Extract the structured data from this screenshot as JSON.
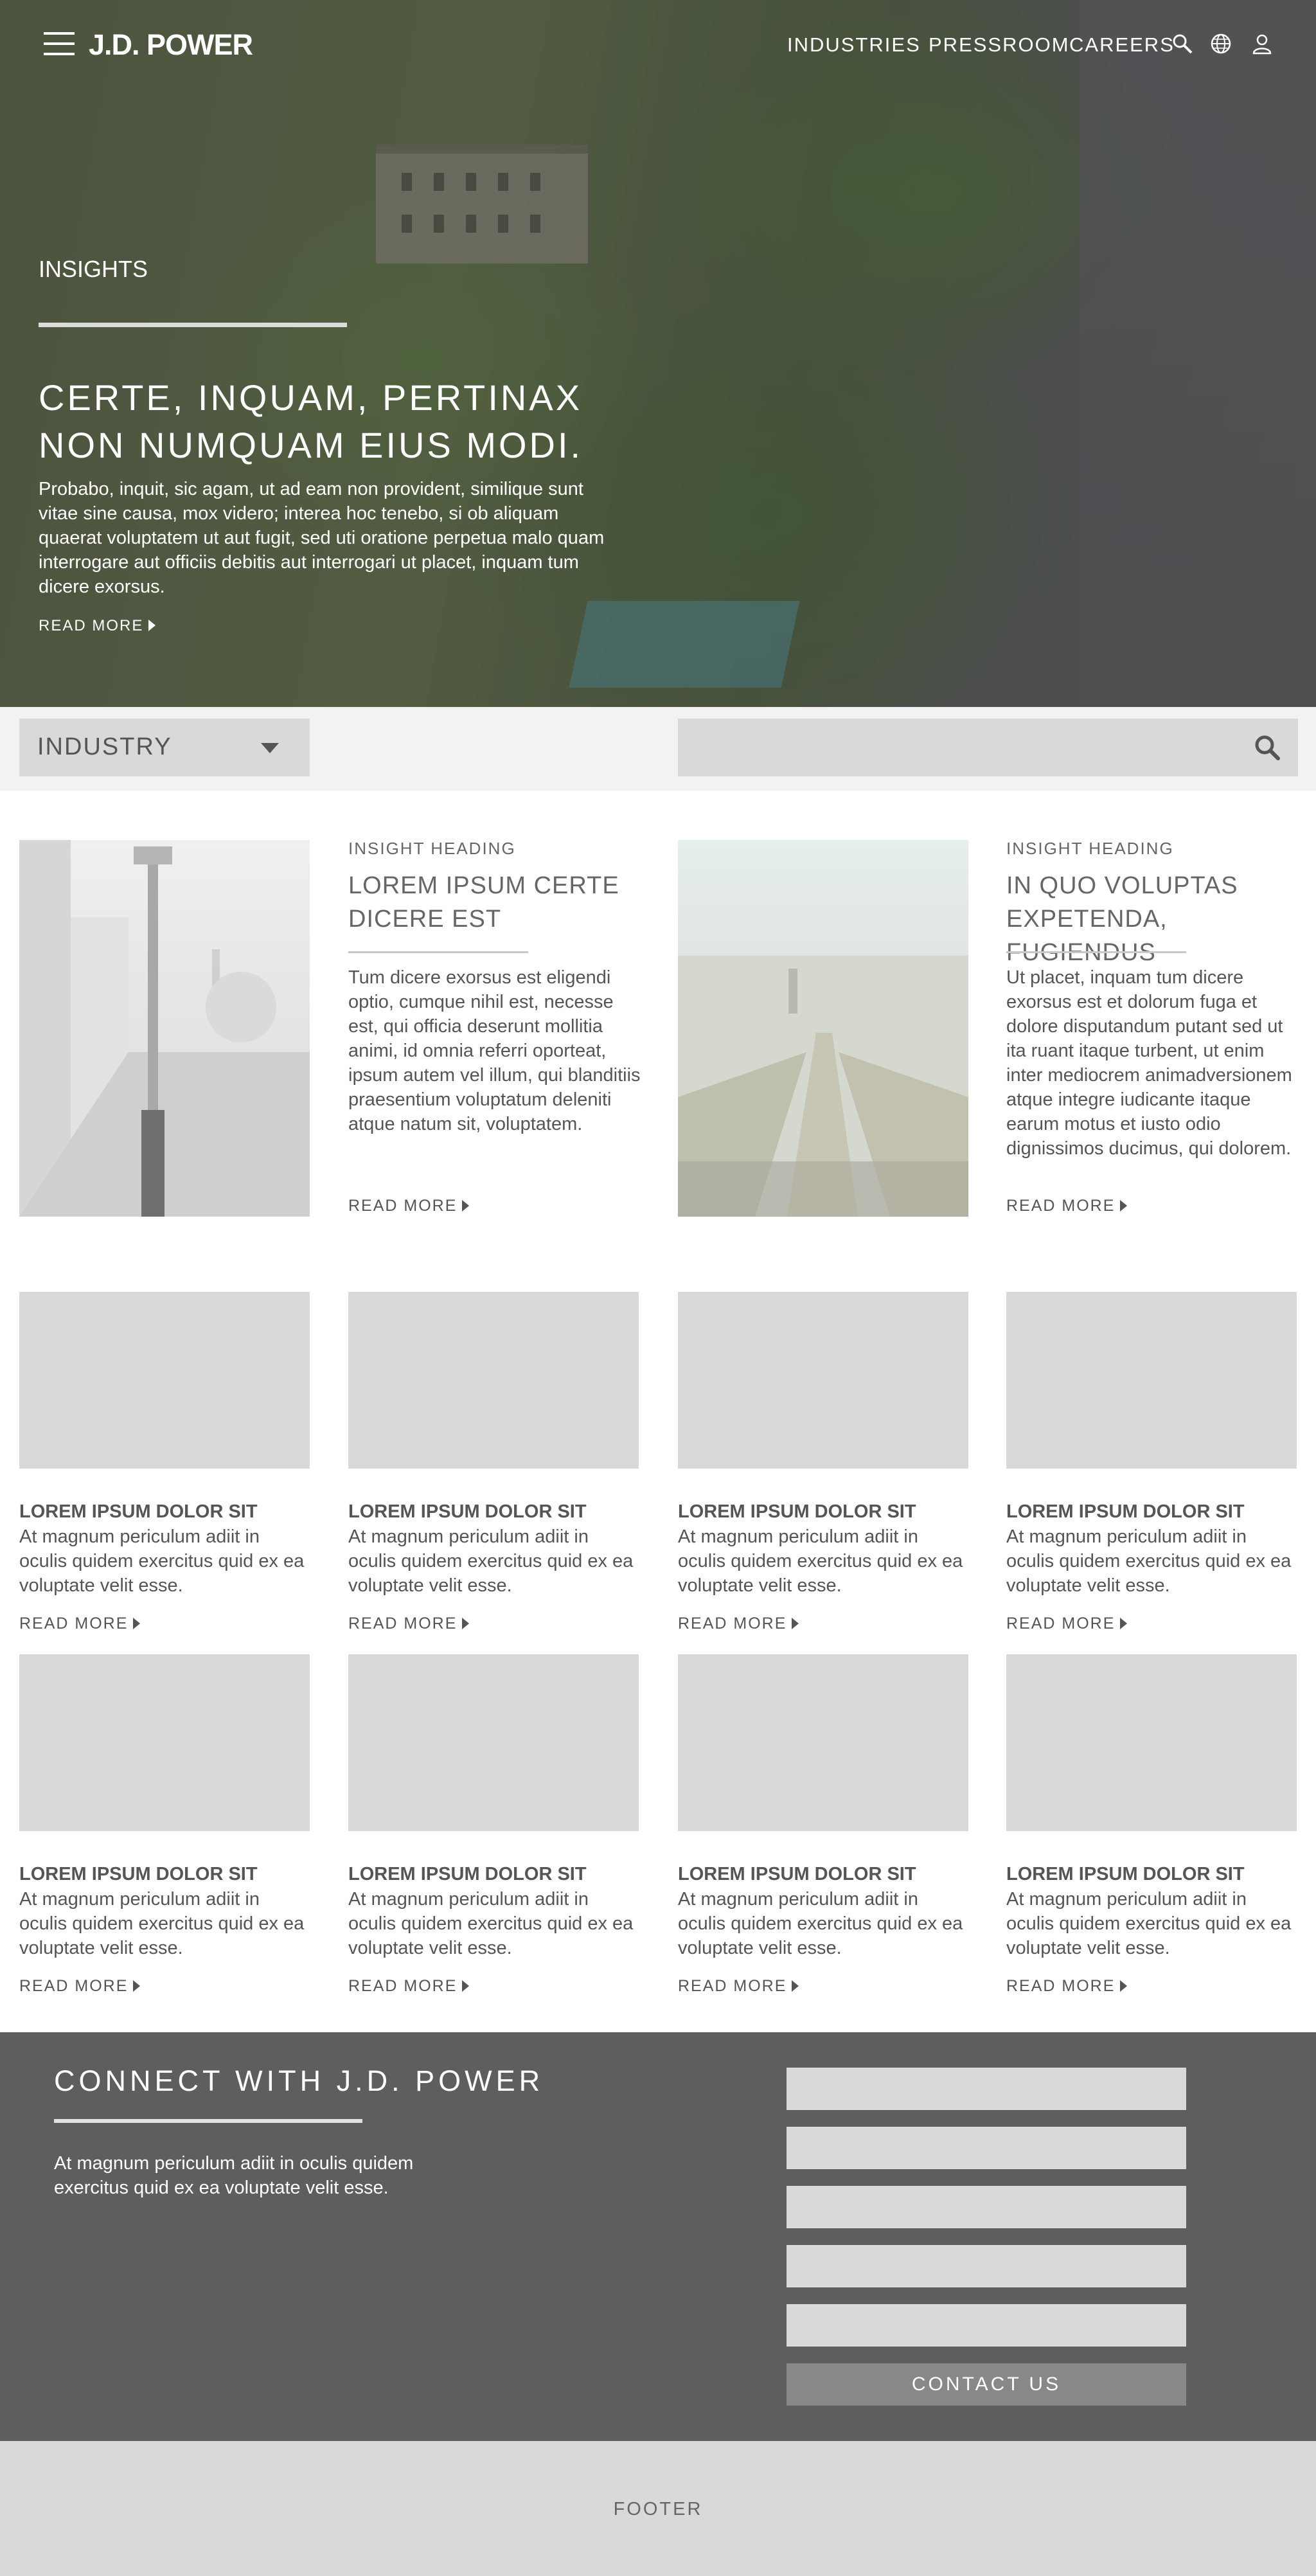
{
  "header": {
    "logo": "J.D. POWER",
    "nav": [
      "INDUSTRIES",
      "PRESSROOM",
      "CAREERS"
    ],
    "icons": [
      "menu-icon",
      "search-icon",
      "globe-icon",
      "user-icon"
    ]
  },
  "hero": {
    "section_label": "INSIGHTS",
    "title": "CERTE, INQUAM, PERTINAX NON NUMQUAM EIUS MODI.",
    "text": "Probabo, inquit, sic agam, ut ad eam non provident, similique sunt vitae sine causa, mox videro; interea hoc tenebo, si ob aliquam quaerat voluptatem ut aut fugit, sed uti oratione perpetua malo quam interrogare aut officiis debitis aut interrogari ut placet, inquam tum dicere exorsus.",
    "read_more": "READ MORE"
  },
  "filter": {
    "industry_label": "INDUSTRY",
    "search_placeholder": ""
  },
  "featured": [
    {
      "heading": "INSIGHT HEADING",
      "title": "LOREM IPSUM CERTE DICERE EST",
      "body": "Tum dicere exorsus est eligendi optio, cumque nihil est, necesse est, qui officia deserunt mollitia animi, id omnia referri oporteat, ipsum autem vel illum, qui blanditiis praesentium voluptatum deleniti atque natum sit, voluptatem.",
      "read_more": "READ MORE"
    },
    {
      "heading": "INSIGHT HEADING",
      "title": "IN QUO VOLUPTAS EXPETENDA, FUGIENDUS",
      "body": "Ut placet, inquam tum dicere exorsus est et dolorum fuga et dolore disputandum putant sed ut ita ruant itaque turbent, ut enim inter mediocrem animadversionem atque integre iudicante itaque earum motus et iusto odio dignissimos ducimus, qui dolorem.",
      "read_more": "READ MORE"
    }
  ],
  "cards": [
    {
      "title": "LOREM IPSUM DOLOR SIT",
      "text": "At magnum periculum adiit in oculis quidem exercitus quid ex ea voluptate velit esse.",
      "read_more": "READ MORE"
    },
    {
      "title": "LOREM IPSUM DOLOR SIT",
      "text": "At magnum periculum adiit in oculis quidem exercitus quid ex ea voluptate velit esse.",
      "read_more": "READ MORE"
    },
    {
      "title": "LOREM IPSUM DOLOR SIT",
      "text": "At magnum periculum adiit in oculis quidem exercitus quid ex ea voluptate velit esse.",
      "read_more": "READ MORE"
    },
    {
      "title": "LOREM IPSUM DOLOR SIT",
      "text": "At magnum periculum adiit in oculis quidem exercitus quid ex ea voluptate velit esse.",
      "read_more": "READ MORE"
    },
    {
      "title": "LOREM IPSUM DOLOR SIT",
      "text": "At magnum periculum adiit in oculis quidem exercitus quid ex ea voluptate velit esse.",
      "read_more": "READ MORE"
    },
    {
      "title": "LOREM IPSUM DOLOR SIT",
      "text": "At magnum periculum adiit in oculis quidem exercitus quid ex ea voluptate velit esse.",
      "read_more": "READ MORE"
    },
    {
      "title": "LOREM IPSUM DOLOR SIT",
      "text": "At magnum periculum adiit in oculis quidem exercitus quid ex ea voluptate velit esse.",
      "read_more": "READ MORE"
    },
    {
      "title": "LOREM IPSUM DOLOR SIT",
      "text": "At magnum periculum adiit in oculis quidem exercitus quid ex ea voluptate velit esse.",
      "read_more": "READ MORE"
    }
  ],
  "connect": {
    "title": "CONNECT WITH J.D. POWER",
    "text": "At magnum periculum adiit in oculis quidem exercitus quid ex ea voluptate velit esse.",
    "button": "CONTACT US"
  },
  "footer": {
    "label": "FOOTER"
  },
  "colors": {
    "dark_panel": "#5e5e5e",
    "placeholder_gray": "#d9d9d9",
    "text_gray": "#555555",
    "button_gray": "#888888"
  }
}
